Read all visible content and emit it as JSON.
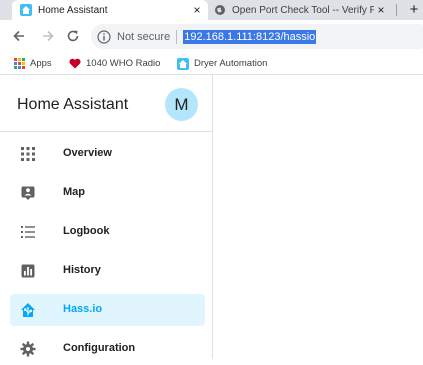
{
  "browser": {
    "tabs": [
      {
        "title": "Home Assistant",
        "close": "×",
        "active": true
      },
      {
        "title": "Open Port Check Tool -- Verify P",
        "close": "×",
        "active": false
      }
    ],
    "new_tab": "+",
    "security_label": "Not secure",
    "url": "192.168.1.111:8123/hassio"
  },
  "bookmarks": [
    {
      "label": "Apps",
      "icon": "apps-grid-icon"
    },
    {
      "label": "1040 WHO Radio",
      "icon": "iheart-icon"
    },
    {
      "label": "Dryer Automation",
      "icon": "home-assistant-icon"
    }
  ],
  "app": {
    "title": "Home Assistant",
    "avatar_initial": "M",
    "nav": [
      {
        "label": "Overview",
        "icon": "grid-icon"
      },
      {
        "label": "Map",
        "icon": "map-person-icon"
      },
      {
        "label": "Logbook",
        "icon": "list-icon"
      },
      {
        "label": "History",
        "icon": "chart-bar-icon"
      },
      {
        "label": "Hass.io",
        "icon": "hassio-icon",
        "selected": true
      },
      {
        "label": "Configuration",
        "icon": "gear-icon"
      }
    ]
  },
  "colors": {
    "accent": "#03a9f4",
    "selected_bg": "#e1f5fe",
    "avatar_bg": "#b3e5fc",
    "url_highlight": "#3b78e7"
  }
}
